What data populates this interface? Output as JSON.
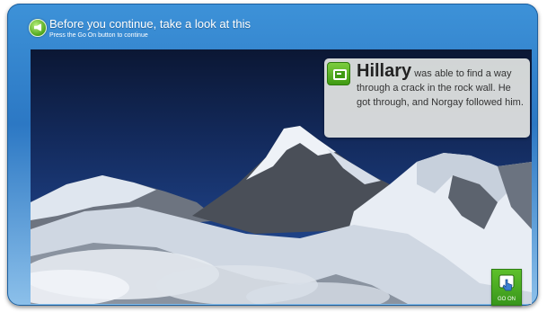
{
  "header": {
    "icon": "info-speaker-icon",
    "title": "Before you continue, take a look at this",
    "subtitle": "Press the Go On button to continue"
  },
  "caption": {
    "icon": "note-card-icon",
    "name": "Hillary",
    "text": "was able to find a way through a crack in the rock wall. He got through, and Norgay followed him."
  },
  "go_on": {
    "label": "GO ON",
    "icon": "hand-pointer-icon"
  },
  "colors": {
    "frame": "#2c78c4",
    "accent_green": "#4ea51b",
    "sky": "#132a5c"
  }
}
